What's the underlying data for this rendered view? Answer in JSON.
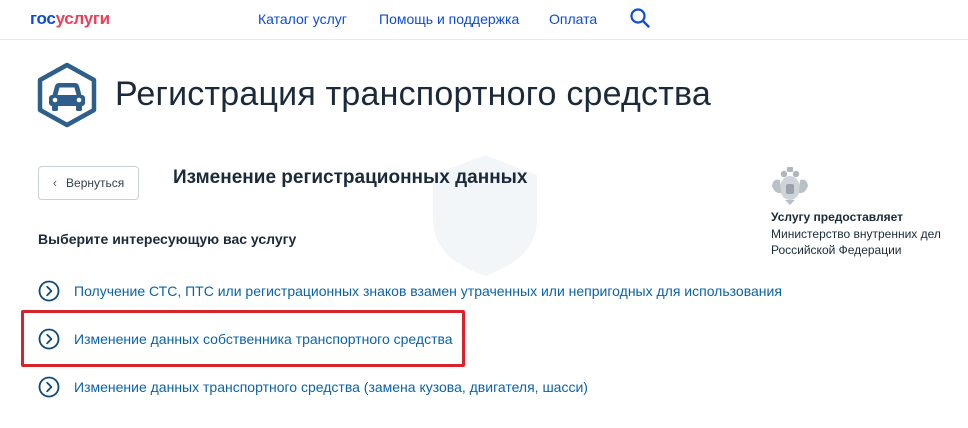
{
  "header": {
    "logo_part1": "гос",
    "logo_part2": "услуги",
    "nav": [
      "Каталог услуг",
      "Помощь и поддержка",
      "Оплата"
    ],
    "search_icon": "search-icon",
    "brand_colors": {
      "blue": "#0d4cd3",
      "red": "#ee3f58"
    }
  },
  "page": {
    "title": "Регистрация транспортного средства",
    "title_icon": "car-icon",
    "back_label": "Вернуться",
    "subsection_title": "Изменение регистрационных данных",
    "choose_heading": "Выберите интересующую вас услугу"
  },
  "services": [
    {
      "label": "Получение СТС, ПТС или регистрационных знаков взамен утраченных или непригодных для использования",
      "highlighted": false
    },
    {
      "label": "Изменение данных собственника транспортного средства",
      "highlighted": true
    },
    {
      "label": "Изменение данных транспортного средства (замена кузова, двигателя, шасси)",
      "highlighted": false
    }
  ],
  "provider": {
    "label": "Услугу предоставляет",
    "name_line1": "Министерство внутренних дел",
    "name_line2": "Российской Федерации",
    "emblem_icon": "coat-of-arms-icon"
  },
  "colors": {
    "link": "#0b63a5",
    "highlight": "#d8232a",
    "icon": "#2d5f8a"
  }
}
